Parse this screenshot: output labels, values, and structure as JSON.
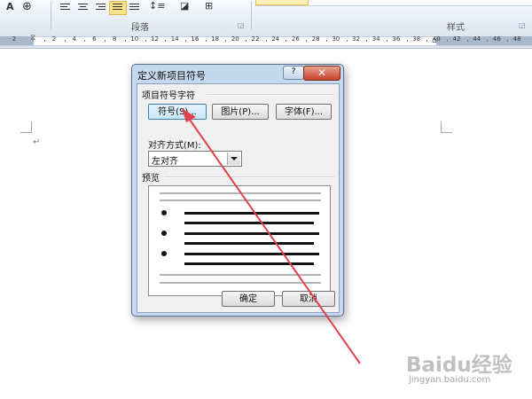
{
  "ribbon": {
    "paragraph_group_label": "段落",
    "styles_group_label": "样式"
  },
  "ruler": {
    "labels": [
      "2",
      "2",
      "4",
      "6",
      "8",
      "10",
      "12",
      "14",
      "16",
      "18",
      "20",
      "22",
      "24",
      "26",
      "28",
      "30",
      "32",
      "34",
      "36",
      "38",
      "40",
      "42",
      "44",
      "46",
      "48"
    ]
  },
  "document": {
    "paragraph_mark": "↵"
  },
  "dialog": {
    "title": "定义新项目符号",
    "help_label": "?",
    "close_label": "✕",
    "bullet_char_group": "项目符号字符",
    "symbol_button": "符号(S)...",
    "picture_button": "图片(P)...",
    "font_button": "字体(F)...",
    "alignment_label": "对齐方式(M):",
    "alignment_value": "左对齐",
    "preview_label": "预览",
    "ok_button": "确定",
    "cancel_button": "取消"
  },
  "annotation": {
    "color": "#e0414a"
  },
  "watermark": {
    "logo": "Baidu经验",
    "url": "jingyan.baidu.com"
  }
}
